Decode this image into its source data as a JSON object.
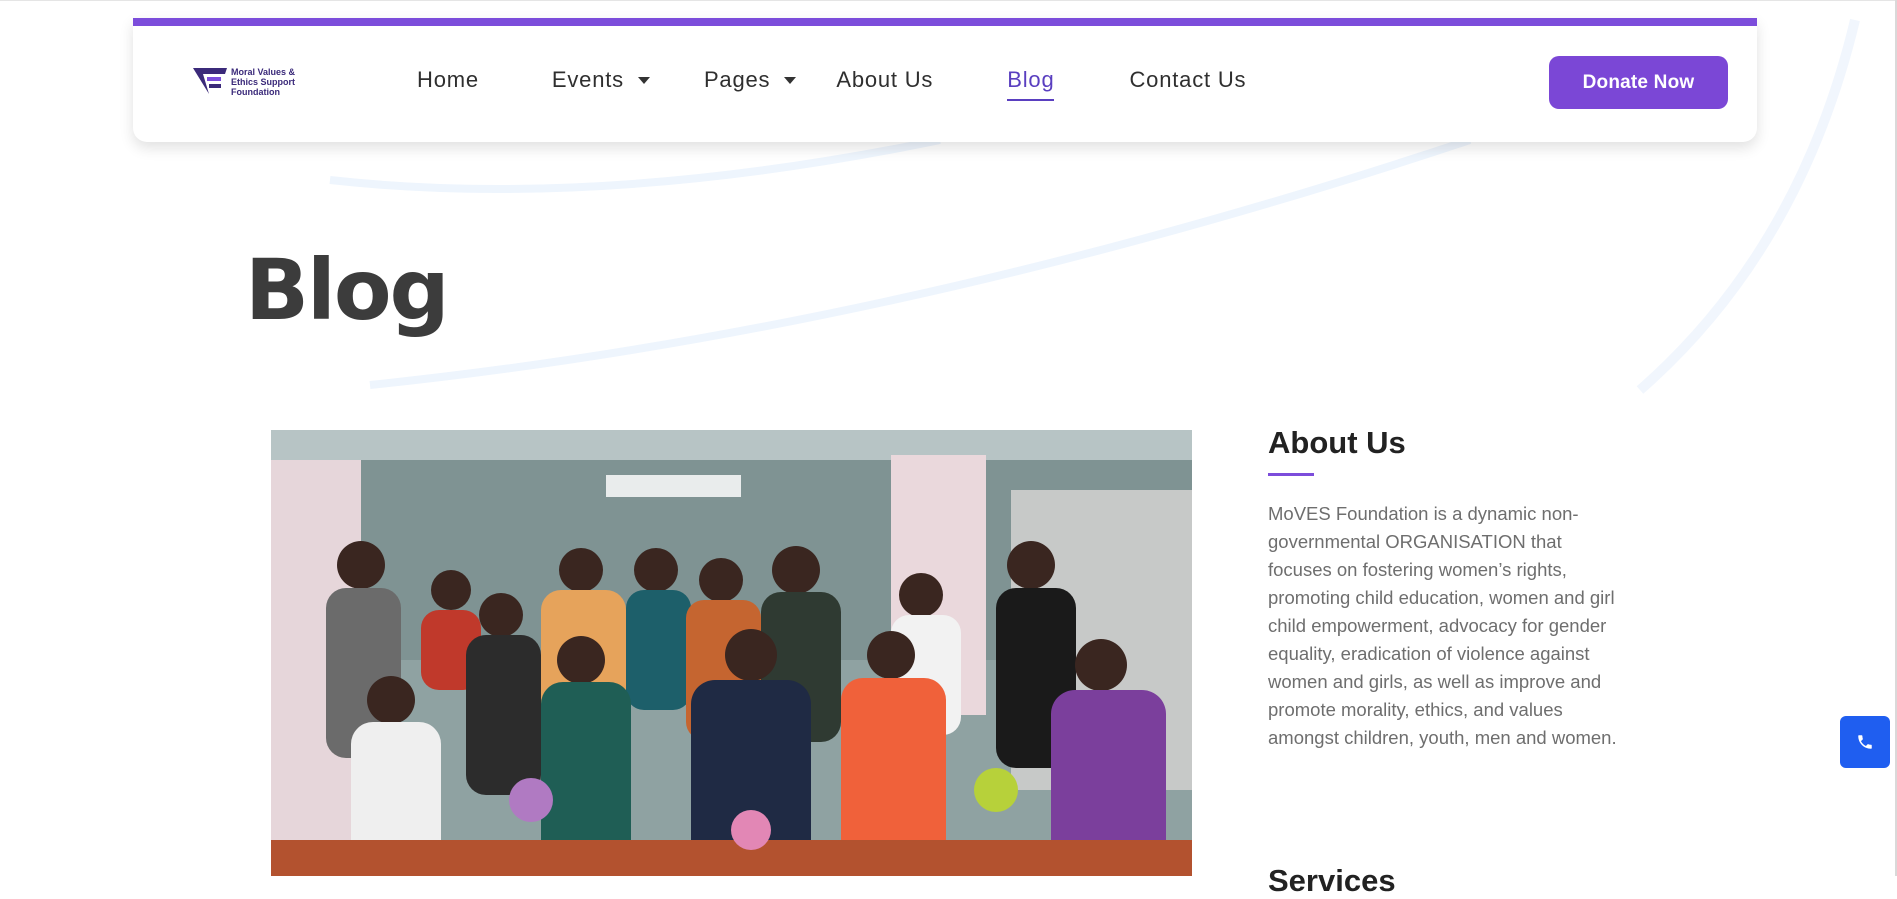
{
  "brand": {
    "logo_lines": [
      "Moral Values &",
      "Ethics Support",
      "Foundation"
    ],
    "accent_color": "#7c4ddb",
    "logo_icon": "moves-logo-icon"
  },
  "nav": {
    "items": [
      {
        "label": "Home",
        "has_dropdown": false,
        "active": false
      },
      {
        "label": "Events",
        "has_dropdown": true,
        "active": false
      },
      {
        "label": "Pages",
        "has_dropdown": true,
        "active": false
      },
      {
        "label": "About Us",
        "has_dropdown": false,
        "active": false
      },
      {
        "label": "Blog",
        "has_dropdown": false,
        "active": true
      },
      {
        "label": "Contact Us",
        "has_dropdown": false,
        "active": false
      }
    ],
    "donate_label": "Donate Now",
    "donate_color": "#7b47d6"
  },
  "page": {
    "title": "Blog"
  },
  "sidebar": {
    "about_heading": "About Us",
    "about_text": "MoVES Foundation is a dynamic non-governmental ORGANISATION that focuses on fostering women’s rights, promoting child education, women and girl child empowerment, advocacy for gender equality, eradication of violence against women and girls, as well as improve and promote morality, ethics, and values amongst children, youth, men and women.",
    "services_heading": "Services"
  },
  "floating": {
    "call_icon": "phone-icon",
    "call_color": "#1f5ef0"
  }
}
